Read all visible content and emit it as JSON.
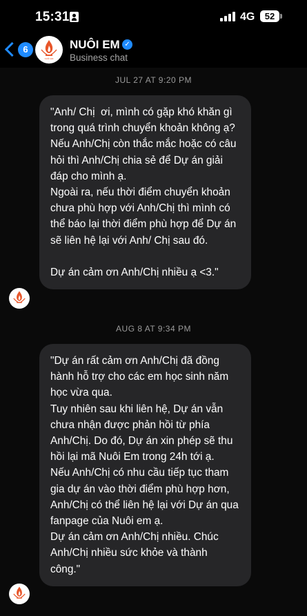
{
  "status": {
    "time": "15:31",
    "network": "4G",
    "battery": "52"
  },
  "header": {
    "back_count": "6",
    "title": "NUÔI EM",
    "subtitle": "Business chat",
    "verified_mark": "✓"
  },
  "messages": [
    {
      "timestamp": "JUL 27 AT 9:20 PM",
      "text": "\"Anh/ Chị  ơi, mình có gặp khó khăn gì trong quá trình chuyển khoản không ạ?\nNếu Anh/Chị còn thắc mắc hoặc có câu hỏi thì Anh/Chị chia sẻ để Dự án giải đáp cho mình ạ.\nNgoài ra, nếu thời điểm chuyển khoản chưa phù hợp với Anh/Chị thì mình có thể báo lại thời điểm phù hợp để Dự án sẽ liên hệ lại với Anh/ Chị sau đó.\n\nDự án cảm ơn Anh/Chị nhiều ạ <3.\""
    },
    {
      "timestamp": "AUG 8 AT 9:34 PM",
      "text": "\"Dự án rất cảm ơn Anh/Chị đã đồng hành hỗ trợ cho các em học sinh năm học vừa qua.\nTuy nhiên sau khi liên hệ, Dự án vẫn chưa nhận được phản hồi từ phía Anh/Chị. Do đó, Dự án xin phép sẽ thu hồi lại mã Nuôi Em trong 24h tới ạ.\nNếu Anh/Chị có nhu cầu tiếp tục tham gia dự án vào thời điểm phù hợp hơn, Anh/Chị có thể liên hệ lại với Dự án qua fanpage của Nuôi em ạ.\nDự án cảm ơn Anh/Chị nhiều. Chúc Anh/Chị nhiều sức khỏe và thành công.\""
    }
  ],
  "icons": {
    "logo": "candle-flame-logo",
    "back": "chevron-left-icon",
    "verified": "verified-badge-icon"
  },
  "colors": {
    "accent": "#1f8bff",
    "bubble": "#262628",
    "logo": "#e8562a"
  }
}
